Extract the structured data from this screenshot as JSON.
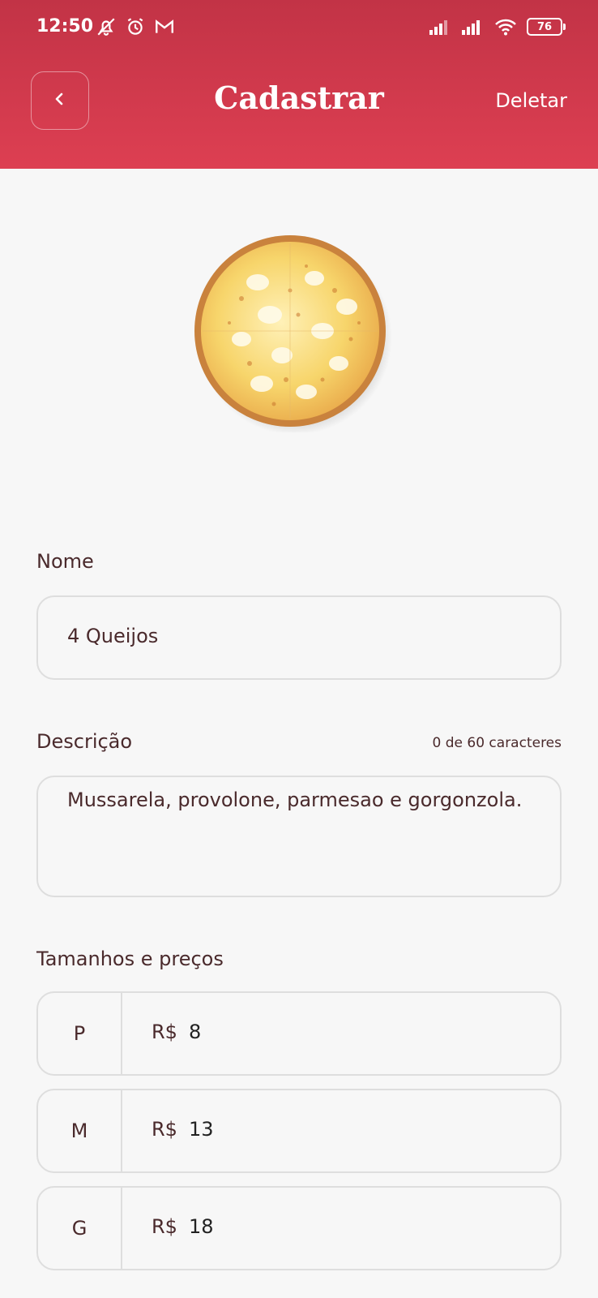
{
  "status_bar": {
    "time": "12:50",
    "battery": "76",
    "icons": [
      "muted-bell-icon",
      "alarm-icon",
      "gmail-icon",
      "signal-icon",
      "signal-icon",
      "wifi-icon",
      "battery-icon"
    ]
  },
  "header": {
    "title": "Cadastrar",
    "delete_label": "Deletar",
    "back_icon": "chevron-left-icon",
    "colors": {
      "top": "#c23346",
      "bottom": "#dd3f52"
    }
  },
  "form": {
    "name_label": "Nome",
    "name_value": "4 Queijos",
    "description_label": "Descrição",
    "description_counter": "0 de 60 caracteres",
    "description_value": "Mussarela, provolone, parmesao e gorgonzola.",
    "sizes_label": "Tamanhos e preços",
    "sizes": [
      {
        "size": "P",
        "currency": "R$",
        "price": "8"
      },
      {
        "size": "M",
        "currency": "R$",
        "price": "13"
      },
      {
        "size": "G",
        "currency": "R$",
        "price": "18"
      }
    ]
  }
}
